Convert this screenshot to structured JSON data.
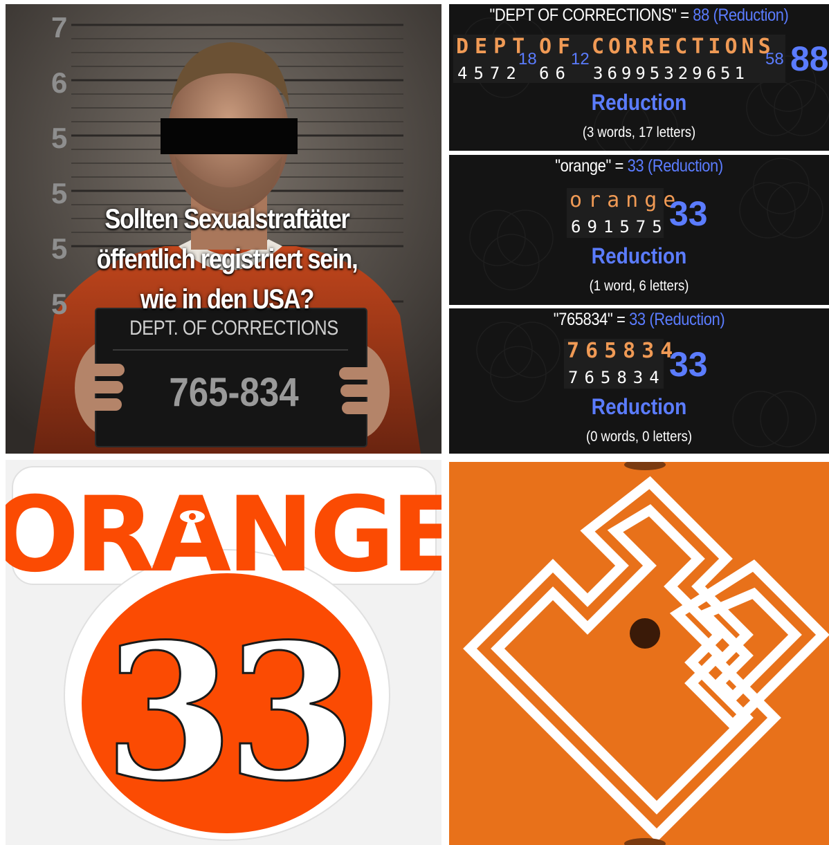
{
  "mugshot": {
    "question_line1": "Sollten Sexualstraftäter",
    "question_line2": "öffentlich registriert sein,",
    "question_line3": "wie in den USA?",
    "board_title": "DEPT. OF CORRECTIONS",
    "board_number": "765-834",
    "ruler_marks": [
      "7",
      "6",
      "5",
      "5",
      "5",
      "5"
    ]
  },
  "gematria": [
    {
      "heading_phrase": "\"DEPT OF CORRECTIONS\" = ",
      "heading_value": "88 (Reduction)",
      "words": [
        "DEPT",
        "OF",
        "CORRECTIONS"
      ],
      "word_digits": [
        "4572",
        "66",
        "36995329651"
      ],
      "word_sums": [
        "18",
        "12",
        "58"
      ],
      "total": "88",
      "cipher": "Reduction",
      "counts": "(3 words, 17 letters)"
    },
    {
      "heading_phrase": "\"orange\" = ",
      "heading_value": "33 (Reduction)",
      "words": [
        "orange"
      ],
      "word_digits": [
        "691575"
      ],
      "word_sums": [],
      "total": "33",
      "cipher": "Reduction",
      "counts": "(1 word, 6 letters)"
    },
    {
      "heading_phrase": "\"765834\" = ",
      "heading_value": "33 (Reduction)",
      "words": [
        "765834"
      ],
      "word_digits": [
        "765834"
      ],
      "word_sums": [],
      "total": "33",
      "cipher": "Reduction",
      "counts": "(0 words, 0 letters)"
    }
  ],
  "sticker": {
    "word": "ORANGE",
    "number": "33",
    "color": "#fb4b03"
  },
  "symbol_panel": {
    "background": "#e8711a",
    "icon": "interlocking-square-glyph"
  }
}
